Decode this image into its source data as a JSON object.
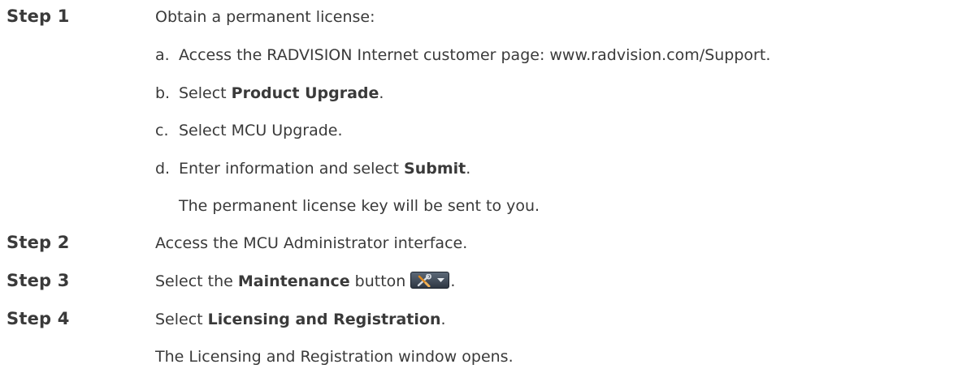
{
  "steps": [
    {
      "label": "Step 1",
      "text": "Obtain a permanent license:"
    },
    {
      "label": "Step 2",
      "text": "Access the MCU Administrator interface."
    },
    {
      "label": "Step 3",
      "text_before": "Select the ",
      "bold": "Maintenance",
      "text_after": " button",
      "text_end": ".",
      "icon": "maintenance-tools-icon"
    },
    {
      "label": "Step 4",
      "text_before": "Select ",
      "bold": "Licensing and Registration",
      "text_after": ".",
      "note": "The Licensing and Registration window opens."
    }
  ],
  "substeps": [
    {
      "letter": "a.",
      "text": "Access the RADVISION Internet customer page: www.radvision.com/Support."
    },
    {
      "letter": "b.",
      "text_before": "Select ",
      "bold": "Product Upgrade",
      "text_after": "."
    },
    {
      "letter": "c.",
      "text": "Select MCU Upgrade."
    },
    {
      "letter": "d.",
      "text_before": "Enter information and select ",
      "bold": "Submit",
      "text_after": "."
    }
  ],
  "substep_note": "The permanent license key will be sent to you.",
  "colors": {
    "text": "#3a3a3a",
    "button_top": "#5c6877",
    "button_bottom": "#2e3743",
    "tool_accent": "#e08a1e"
  }
}
